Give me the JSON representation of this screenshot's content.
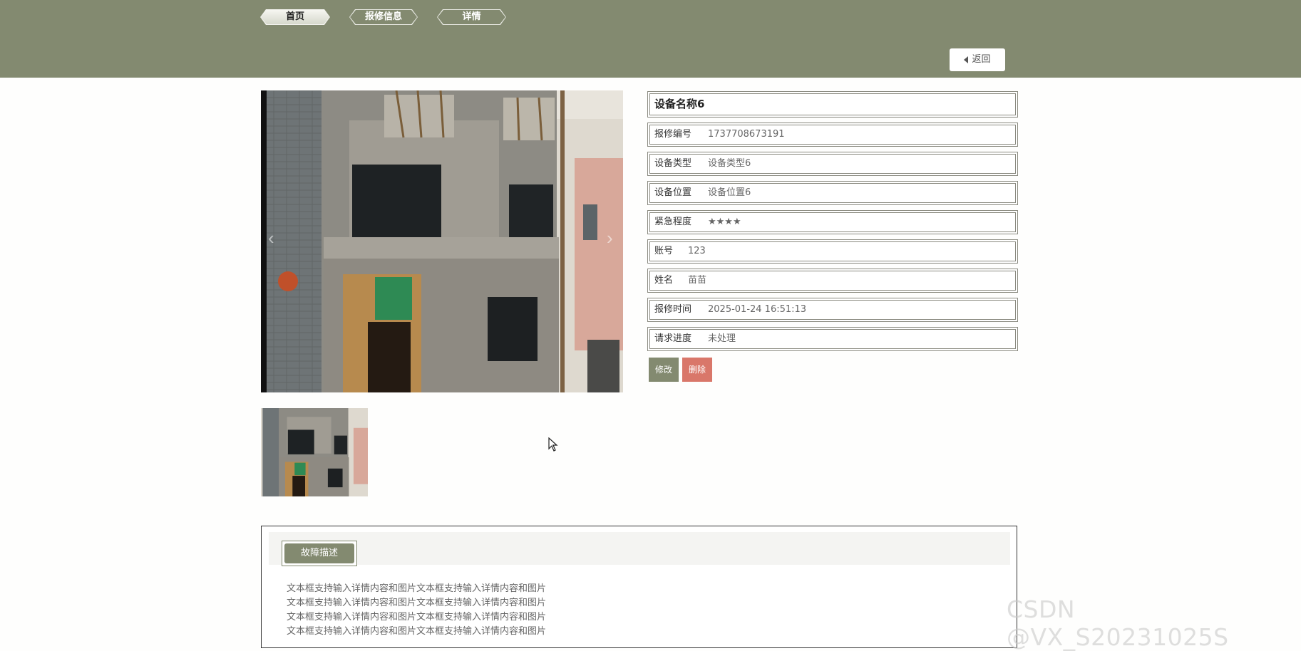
{
  "nav": {
    "tabs": [
      {
        "label": "首页"
      },
      {
        "label": "报修信息"
      },
      {
        "label": "详情"
      }
    ],
    "back_label": "返回"
  },
  "detail": {
    "title": "设备名称6",
    "fields": [
      {
        "label": "报修编号",
        "value": "1737708673191"
      },
      {
        "label": "设备类型",
        "value": "设备类型6"
      },
      {
        "label": "设备位置",
        "value": "设备位置6"
      },
      {
        "label": "紧急程度",
        "value": "★★★★"
      },
      {
        "label": "账号",
        "value": "123"
      },
      {
        "label": "姓名",
        "value": "苗苗"
      },
      {
        "label": "报修时间",
        "value": "2025-01-24 16:51:13"
      },
      {
        "label": "请求进度",
        "value": "未处理"
      }
    ]
  },
  "actions": {
    "edit_label": "修改",
    "delete_label": "删除"
  },
  "description": {
    "tab_label": "故障描述",
    "lines": [
      "文本框支持输入详情内容和图片文本框支持输入详情内容和图片",
      "文本框支持输入详情内容和图片文本框支持输入详情内容和图片",
      "文本框支持输入详情内容和图片文本框支持输入详情内容和图片",
      "文本框支持输入详情内容和图片文本框支持输入详情内容和图片"
    ]
  },
  "watermark": "CSDN @VX_S20231025S",
  "colors": {
    "header_bg": "#838a70",
    "accent": "#838a70",
    "danger": "#d9776a"
  }
}
